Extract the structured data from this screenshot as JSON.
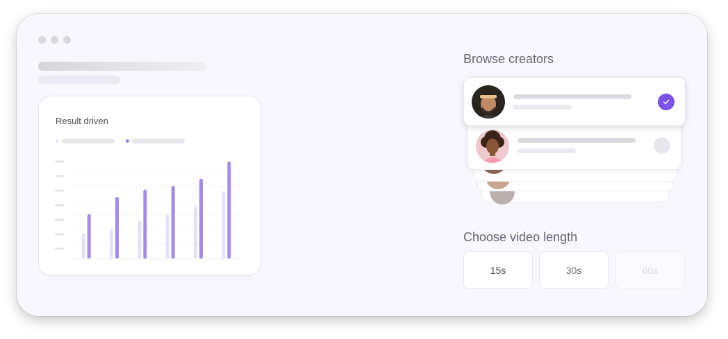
{
  "chart": {
    "title": "Result driven",
    "legend_colors": [
      "#e9e5fb",
      "#9e82e8"
    ]
  },
  "chart_data": {
    "type": "bar",
    "title": "Result driven",
    "categories": [
      "",
      "",
      "",
      "",
      "",
      ""
    ],
    "series": [
      {
        "values": [
          28,
          33,
          42,
          49,
          58,
          74
        ],
        "color": "#e6e0fa"
      },
      {
        "values": [
          49,
          68,
          76,
          80,
          88,
          107
        ],
        "color": "#a58aeb"
      }
    ],
    "ylim": [
      0,
      110
    ],
    "grid": true
  },
  "creators": {
    "title": "Browse creators",
    "items": [
      {
        "selected": true
      },
      {
        "selected": false
      }
    ],
    "check_color": "#7c52e8"
  },
  "video_length": {
    "title": "Choose video length",
    "options": [
      {
        "label": "15s",
        "state": "enabled"
      },
      {
        "label": "30s",
        "state": "enabled"
      },
      {
        "label": "60s",
        "state": "disabled"
      }
    ]
  }
}
